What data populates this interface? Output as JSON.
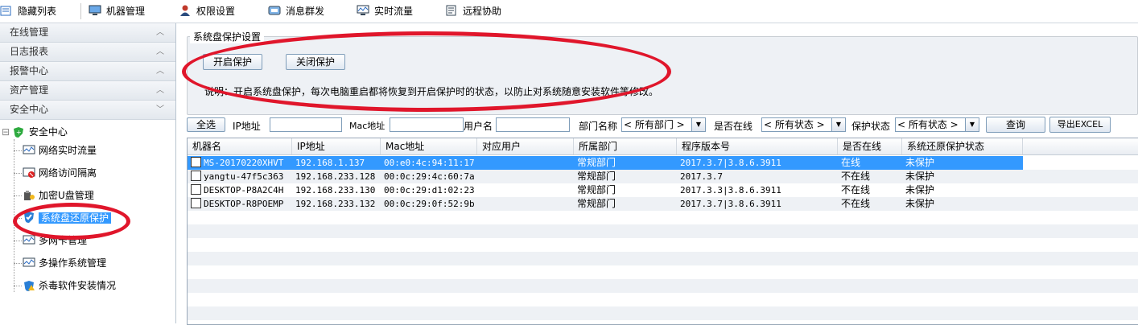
{
  "toolbar": {
    "items": [
      {
        "label": "隐藏列表",
        "icon": "list-icon"
      },
      {
        "label": "机器管理",
        "icon": "monitor-icon"
      },
      {
        "label": "权限设置",
        "icon": "user-icon"
      },
      {
        "label": "消息群发",
        "icon": "message-icon"
      },
      {
        "label": "实时流量",
        "icon": "traffic-icon"
      },
      {
        "label": "远程协助",
        "icon": "remote-icon"
      }
    ]
  },
  "sidebar": {
    "sections": [
      "在线管理",
      "日志报表",
      "报警中心",
      "资产管理",
      "安全中心"
    ],
    "tree_root": "安全中心",
    "tree_items": [
      {
        "label": "网络实时流量"
      },
      {
        "label": "网络访问隔离"
      },
      {
        "label": "加密U盘管理"
      },
      {
        "label": "系统盘还原保护",
        "selected": true
      },
      {
        "label": "多网卡管理"
      },
      {
        "label": "多操作系统管理"
      },
      {
        "label": "杀毒软件安装情况"
      }
    ]
  },
  "protect": {
    "group_title": "系统盘保护设置",
    "enable_label": "开启保护",
    "disable_label": "关闭保护",
    "note": "说明：开启系统盘保护，每次电脑重启都将恢复到开启保护时的状态，以防止对系统随意安装软件等修改。"
  },
  "filters": {
    "select_all": "全选",
    "ip_label": "IP地址",
    "mac_label": "Mac地址",
    "user_label": "用户名",
    "dept_label": "部门名称",
    "dept_value": "< 所有部门 >",
    "online_label": "是否在线",
    "online_value": "< 所有状态 >",
    "protect_label": "保护状态",
    "protect_value": "< 所有状态 >",
    "query_label": "查询",
    "export_label": "导出EXCEL"
  },
  "table": {
    "columns": [
      "机器名",
      "IP地址",
      "Mac地址",
      "对应用户",
      "所属部门",
      "程序版本号",
      "是否在线",
      "系统还原保护状态"
    ],
    "rows": [
      [
        "MS-20170220XHVT",
        "192.168.1.137",
        "00:e0:4c:94:11:17",
        "",
        "常规部门",
        "2017.3.7|3.8.6.3911",
        "在线",
        "未保护"
      ],
      [
        "yangtu-47f5c363",
        "192.168.233.128",
        "00:0c:29:4c:60:7a",
        "",
        "常规部门",
        "2017.3.7",
        "不在线",
        "未保护"
      ],
      [
        "DESKTOP-P8A2C4H",
        "192.168.233.130",
        "00:0c:29:d1:02:23",
        "",
        "常规部门",
        "2017.3.3|3.8.6.3911",
        "不在线",
        "未保护"
      ],
      [
        "DESKTOP-R8POEMP",
        "192.168.233.132",
        "00:0c:29:0f:52:9b",
        "",
        "常规部门",
        "2017.3.7|3.8.6.3911",
        "不在线",
        "未保护"
      ]
    ]
  },
  "colors": {
    "selection": "#3399ff",
    "annotation": "#e0162b",
    "panel": "#eef1f5"
  }
}
